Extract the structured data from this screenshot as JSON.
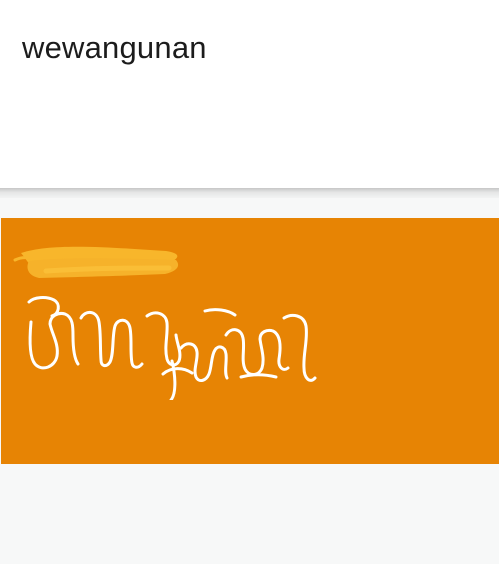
{
  "input": {
    "text": "wewangunan"
  },
  "output": {
    "script": "Javanese",
    "background_color": "#e78404",
    "redaction_color": "#f8b62b"
  }
}
